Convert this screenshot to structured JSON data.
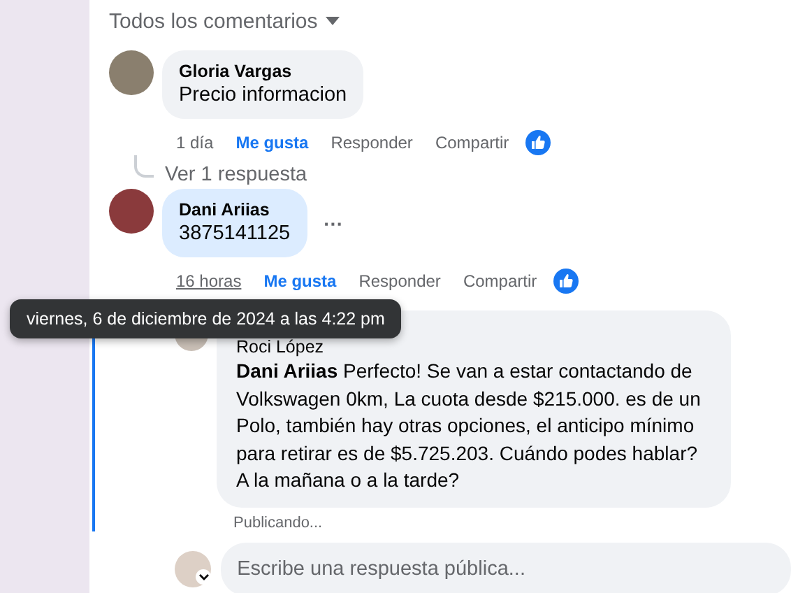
{
  "header": {
    "label": "Todos los comentarios"
  },
  "comments": [
    {
      "author": "Gloria Vargas",
      "text": "Precio informacion",
      "highlighted": false,
      "time": "1 día",
      "actions": [
        "Me gusta",
        "Responder",
        "Compartir"
      ],
      "replies_link": "Ver 1 respuesta"
    },
    {
      "author": "Dani Ariias",
      "text": "3875141125",
      "highlighted": true,
      "time": "16 horas",
      "actions": [
        "Me gusta",
        "Responder",
        "Compartir"
      ],
      "more": "···"
    }
  ],
  "tooltip": {
    "text": "viernes, 6 de diciembre de 2024 a las 4:22 pm"
  },
  "reply": {
    "author": "Roci López",
    "text": "**Dani Ariias** Perfecto! Se van a estar contactando de Volkswagen 0km, La cuota desde $215.000. es de un Polo, también hay otras opciones, el anticipo mínimo para retirar es de $5.725.203. Cuándo podes hablar? A la mañana o a la tarde?",
    "status": "Publicando..."
  },
  "composer": {
    "placeholder": "Escribe una respuesta pública..."
  }
}
